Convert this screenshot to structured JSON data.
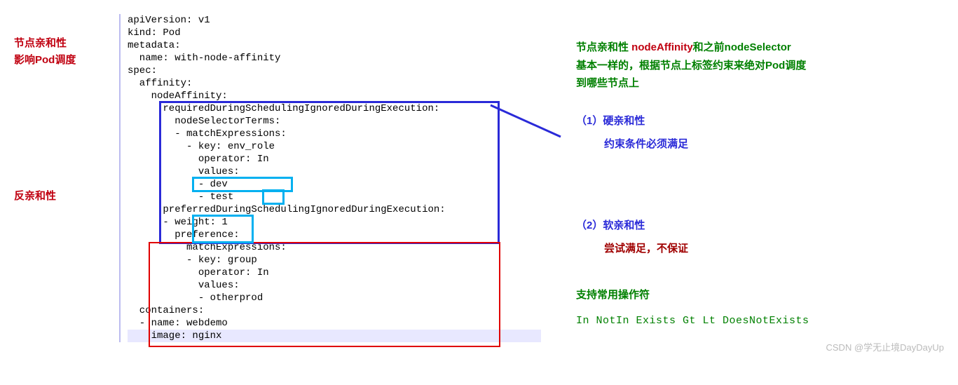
{
  "left": {
    "label1a": "节点亲和性",
    "label1b": "影响Pod调度",
    "label2": "反亲和性"
  },
  "code": {
    "l1": "apiVersion: v1",
    "l2": "kind: Pod",
    "l3": "metadata:",
    "l4": "  name: with-node-affinity",
    "l5": "spec:",
    "l6": "  affinity:",
    "l7": "    nodeAffinity:",
    "l8": "      requiredDuringSchedulingIgnoredDuringExecution:",
    "l9": "        nodeSelectorTerms:",
    "l10": "        - matchExpressions:",
    "l11": "          - key: env_role",
    "l12": "            operator: In",
    "l13": "            values:",
    "l14": "            - dev",
    "l15": "            - test",
    "l16": "      preferredDuringSchedulingIgnoredDuringExecution:",
    "l17": "      - weight: 1",
    "l18": "        preference:",
    "l19": "          matchExpressions:",
    "l20": "          - key: group",
    "l21": "            operator: In",
    "l22": "            values:",
    "l23": "            - otherprod",
    "l24": "  containers:",
    "l25": "  - name: webdemo",
    "l26": "    image: nginx"
  },
  "right": {
    "desc_p1a": "节点亲和性 ",
    "desc_p1b": "nodeAffinity",
    "desc_p1c": "和之前nodeSelector",
    "desc_p2": "基本一样的，根据节点上标签约束来绝对Pod调度",
    "desc_p3": "到哪些节点上",
    "hard_title": "（1）硬亲和性",
    "hard_sub": "约束条件必须满足",
    "soft_title": "（2）软亲和性",
    "soft_sub": "尝试满足，不保证",
    "ops_title": "支持常用操作符",
    "ops_list": "In  NotIn  Exists Gt Lt DoesNotExists"
  },
  "watermark": "CSDN @学无止境DayDayUp"
}
